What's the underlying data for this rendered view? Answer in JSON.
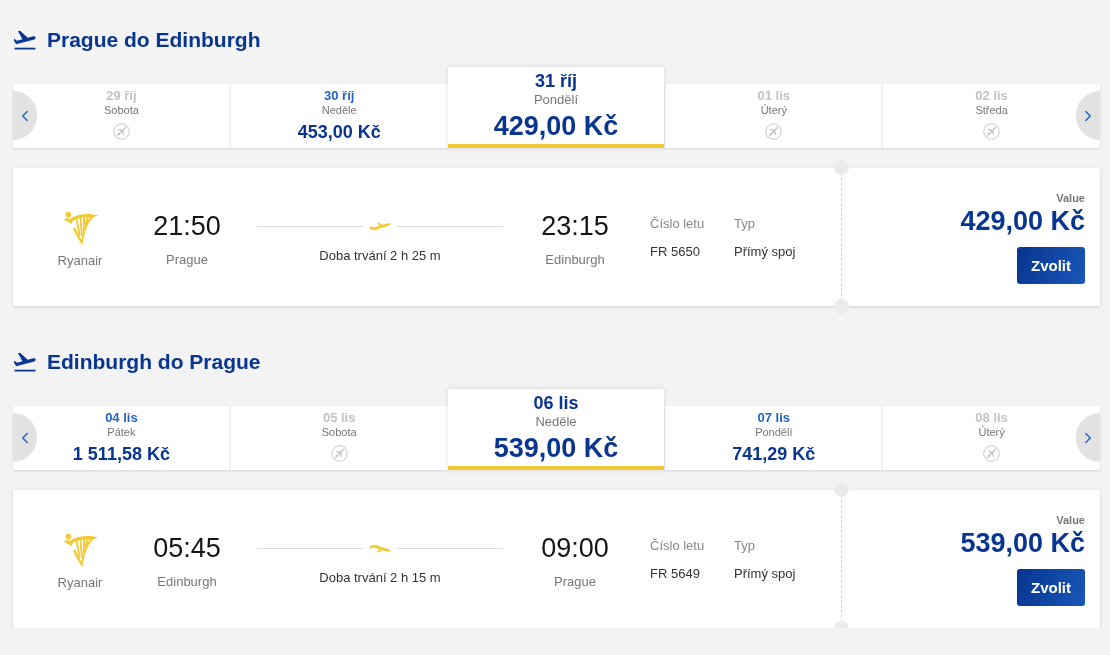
{
  "legs": [
    {
      "kind": "outbound",
      "title": "Prague do Edinburgh",
      "dates": [
        {
          "date": "29 říj",
          "day": "Sobota",
          "available": false,
          "selected": false
        },
        {
          "date": "30 říj",
          "day": "Neděle",
          "price": "453,00 Kč",
          "available": true,
          "selected": false
        },
        {
          "date": "31 říj",
          "day": "Pondělí",
          "price": "429,00 Kč",
          "available": true,
          "selected": true
        },
        {
          "date": "01 lis",
          "day": "Úterý",
          "available": false,
          "selected": false
        },
        {
          "date": "02 lis",
          "day": "Středa",
          "available": false,
          "selected": false
        }
      ],
      "flight": {
        "airline": "Ryanair",
        "departure_time": "21:50",
        "departure_city": "Prague",
        "duration": "Doba trvání 2 h 25 m",
        "arrival_time": "23:15",
        "arrival_city": "Edinburgh",
        "flight_number_label": "Číslo letu",
        "flight_number": "FR 5650",
        "type_label": "Typ",
        "type": "Přímý spoj",
        "fare_label": "Value",
        "price": "429,00 Kč",
        "button": "Zvolit"
      }
    },
    {
      "kind": "return",
      "title": "Edinburgh do Prague",
      "dates": [
        {
          "date": "04 lis",
          "day": "Pátek",
          "price": "1 511,58 Kč",
          "available": true,
          "selected": false
        },
        {
          "date": "05 lis",
          "day": "Sobota",
          "available": false,
          "selected": false
        },
        {
          "date": "06 lis",
          "day": "Neděle",
          "price": "539,00 Kč",
          "available": true,
          "selected": true
        },
        {
          "date": "07 lis",
          "day": "Pondělí",
          "price": "741,29 Kč",
          "available": true,
          "selected": false
        },
        {
          "date": "08 lis",
          "day": "Úterý",
          "available": false,
          "selected": false
        }
      ],
      "flight": {
        "airline": "Ryanair",
        "departure_time": "05:45",
        "departure_city": "Edinburgh",
        "duration": "Doba trvání 2 h 15 m",
        "arrival_time": "09:00",
        "arrival_city": "Prague",
        "flight_number_label": "Číslo letu",
        "flight_number": "FR 5649",
        "type_label": "Typ",
        "type": "Přímý spoj",
        "fare_label": "Value",
        "price": "539,00 Kč",
        "button": "Zvolit"
      }
    }
  ]
}
